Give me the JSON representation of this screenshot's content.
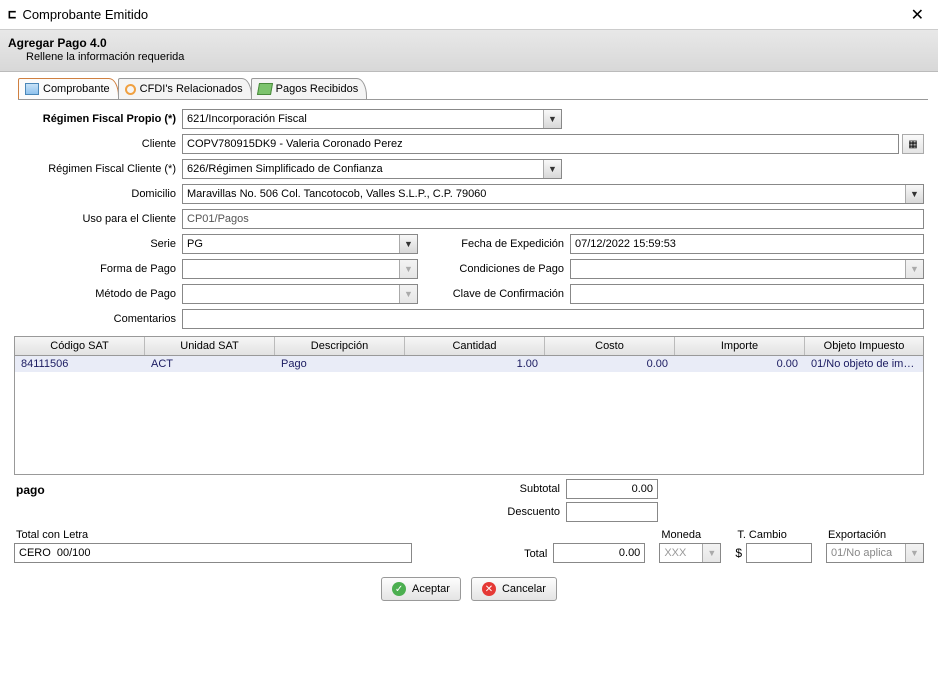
{
  "window": {
    "title": "Comprobante Emitido"
  },
  "header": {
    "title": "Agregar Pago 4.0",
    "subtitle": "Rellene la información requerida"
  },
  "tabs": [
    {
      "label": "Comprobante",
      "active": true
    },
    {
      "label": "CFDI's Relacionados",
      "active": false
    },
    {
      "label": "Pagos Recibidos",
      "active": false
    }
  ],
  "labels": {
    "regimen_propio": "Régimen Fiscal Propio (*)",
    "cliente": "Cliente",
    "regimen_cliente": "Régimen Fiscal Cliente (*)",
    "domicilio": "Domicilio",
    "uso_cliente": "Uso para el Cliente",
    "serie": "Serie",
    "fecha_exp": "Fecha de Expedición",
    "forma_pago": "Forma de Pago",
    "cond_pago": "Condiciones de Pago",
    "metodo_pago": "Método de Pago",
    "clave_conf": "Clave de Confirmación",
    "comentarios": "Comentarios"
  },
  "values": {
    "regimen_propio": "621/Incorporación Fiscal",
    "cliente": "COPV780915DK9 - Valeria Coronado Perez",
    "regimen_cliente": "626/Régimen Simplificado de Confianza",
    "domicilio": "Maravillas No. 506 Col. Tancotocob, Valles S.L.P., C.P. 79060",
    "uso_cliente": "CP01/Pagos",
    "serie": "PG",
    "fecha_exp": "07/12/2022 15:59:53",
    "forma_pago": "",
    "cond_pago": "",
    "metodo_pago": "",
    "clave_conf": "",
    "comentarios": ""
  },
  "grid": {
    "headers": {
      "codigo": "Código SAT",
      "unidad": "Unidad SAT",
      "descripcion": "Descripción",
      "cantidad": "Cantidad",
      "costo": "Costo",
      "importe": "Importe",
      "objeto": "Objeto Impuesto"
    },
    "rows": [
      {
        "codigo": "84111506",
        "unidad": "ACT",
        "descripcion": "Pago",
        "cantidad": "1.00",
        "costo": "0.00",
        "importe": "0.00",
        "objeto": "01/No objeto de imp…"
      }
    ]
  },
  "footer": {
    "pago": "pago",
    "subtotal_label": "Subtotal",
    "subtotal": "0.00",
    "descuento_label": "Descuento",
    "descuento": "",
    "total_letra_label": "Total con Letra",
    "total_letra": "CERO  00/100",
    "total_label": "Total",
    "total": "0.00",
    "moneda_label": "Moneda",
    "moneda": "XXX",
    "tcambio_label": "T. Cambio",
    "tcambio_prefix": "$",
    "tcambio": "",
    "export_label": "Exportación",
    "export": "01/No aplica"
  },
  "buttons": {
    "accept": "Aceptar",
    "cancel": "Cancelar"
  }
}
